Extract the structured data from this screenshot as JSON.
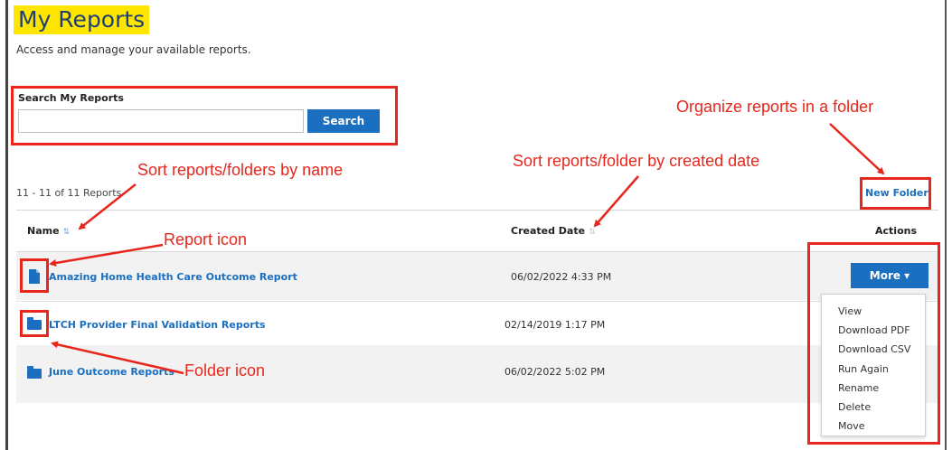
{
  "page": {
    "title": "My Reports",
    "subtitle": "Access and manage your available reports."
  },
  "search": {
    "label": "Search My Reports",
    "value": "",
    "placeholder": "",
    "button_label": "Search"
  },
  "list": {
    "count_text": "11 - 11 of 11 Reports",
    "new_folder_label": "New Folder",
    "columns": {
      "name": "Name",
      "created": "Created Date",
      "actions": "Actions"
    },
    "sort_icon": "⇅",
    "rows": [
      {
        "type": "report",
        "icon": "document-icon",
        "name": "Amazing Home Health Care Outcome Report",
        "created": "06/02/2022 4:33 PM"
      },
      {
        "type": "folder",
        "icon": "folder-icon",
        "name": "LTCH Provider Final Validation Reports",
        "created": "02/14/2019 1:17 PM"
      },
      {
        "type": "folder",
        "icon": "folder-icon",
        "name": "June Outcome Reports",
        "created": "06/02/2022 5:02 PM"
      }
    ]
  },
  "actions_menu": {
    "button_label": "More ▾",
    "items": [
      "View",
      "Download PDF",
      "Download CSV",
      "Run Again",
      "Rename",
      "Delete",
      "Move"
    ]
  },
  "annotations": {
    "organize": "Organize reports in a folder",
    "sort_name": "Sort reports/folders by name",
    "sort_date": "Sort reports/folder by created date",
    "report_icon": "Report icon",
    "folder_icon": "Folder icon",
    "color": "#e8271c"
  },
  "colors": {
    "accent": "#1a6fc0",
    "title_highlight": "#ffe600",
    "row_alt": "#f2f2f2"
  }
}
